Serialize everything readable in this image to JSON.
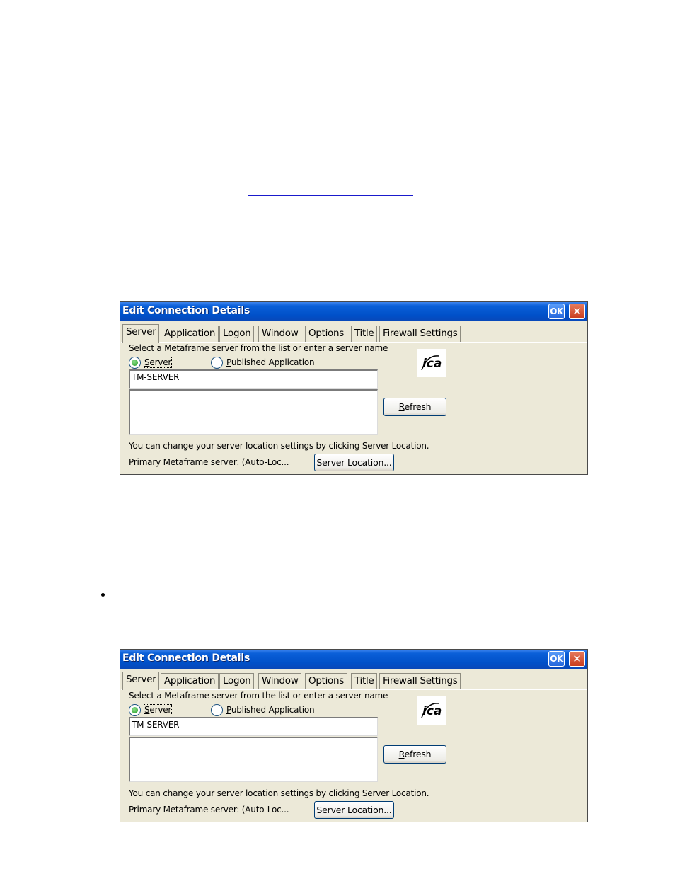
{
  "dialogs": [
    {
      "title": "Edit Connection Details",
      "ok_label": "OK",
      "close_label": "✕",
      "tabs": [
        "Server",
        "Application",
        "Logon",
        "Window",
        "Options",
        "Title",
        "Firewall Settings"
      ],
      "active_tab": "Server",
      "instruction": "Select a Metaframe server from the list or enter a server name",
      "radio_server": "Server",
      "radio_published": "Published Application",
      "selected_radio": "Server",
      "server_value": "TM-SERVER",
      "refresh_label": "Refresh",
      "location_hint": "You can change your server location settings by clicking Server Location.",
      "primary_server": "Primary Metaframe server: (Auto-Loc...",
      "server_location_label": "Server Location...",
      "logo": "ica-logo"
    },
    {
      "title": "Edit Connection Details",
      "ok_label": "OK",
      "close_label": "✕",
      "tabs": [
        "Server",
        "Application",
        "Logon",
        "Window",
        "Options",
        "Title",
        "Firewall Settings"
      ],
      "active_tab": "Server",
      "instruction": "Select a Metaframe server from the list or enter a server name",
      "radio_server": "Server",
      "radio_published": "Published Application",
      "selected_radio": "Server",
      "server_value": "TM-SERVER",
      "refresh_label": "Refresh",
      "location_hint": "You can change your server location settings by clicking Server Location.",
      "primary_server": "Primary Metaframe server: (Auto-Loc...",
      "server_location_label": "Server Location...",
      "logo": "ica-logo"
    }
  ]
}
